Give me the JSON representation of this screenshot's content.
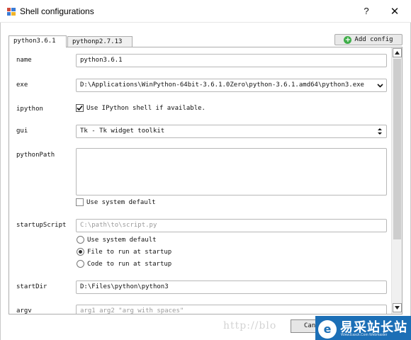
{
  "window": {
    "title": "Shell configurations",
    "help_label": "?",
    "close_label": "✕"
  },
  "tabs": [
    {
      "label": "python3.6.1",
      "selected": true
    },
    {
      "label": "pythonp2.7.13",
      "selected": false
    }
  ],
  "add_config_label": "Add config",
  "form": {
    "name": {
      "label": "name",
      "value": "python3.6.1"
    },
    "exe": {
      "label": "exe",
      "value": "D:\\Applications\\WinPython-64bit-3.6.1.0Zero\\python-3.6.1.amd64\\python3.exe"
    },
    "ipython": {
      "label": "ipython",
      "checkbox_label": "Use IPython shell if available.",
      "checked": true
    },
    "gui": {
      "label": "gui",
      "value": "Tk  -  Tk widget toolkit"
    },
    "pythonPath": {
      "label": "pythonPath",
      "value": "",
      "checkbox_label": "Use system default",
      "checked": false
    },
    "startupScript": {
      "label": "startupScript",
      "placeholder": "C:\\path\\to\\script.py",
      "options": [
        {
          "label": "Use system default",
          "selected": false
        },
        {
          "label": "File to run at startup",
          "selected": true
        },
        {
          "label": "Code to run at startup",
          "selected": false
        }
      ]
    },
    "startDir": {
      "label": "startDir",
      "value": "D:\\Files\\python\\python3"
    },
    "argv": {
      "label": "argv",
      "placeholder": "arg1 arg2 \"arg with spaces\""
    }
  },
  "buttons": {
    "cancel_label": "Can"
  },
  "watermark": {
    "text": "http://blo",
    "badge_cn": "易采站长站",
    "badge_en": "Www.Easck.Com Webmaster"
  },
  "colors": {
    "accent_green": "#3fae49",
    "badge_blue": "#1c6fb6"
  }
}
